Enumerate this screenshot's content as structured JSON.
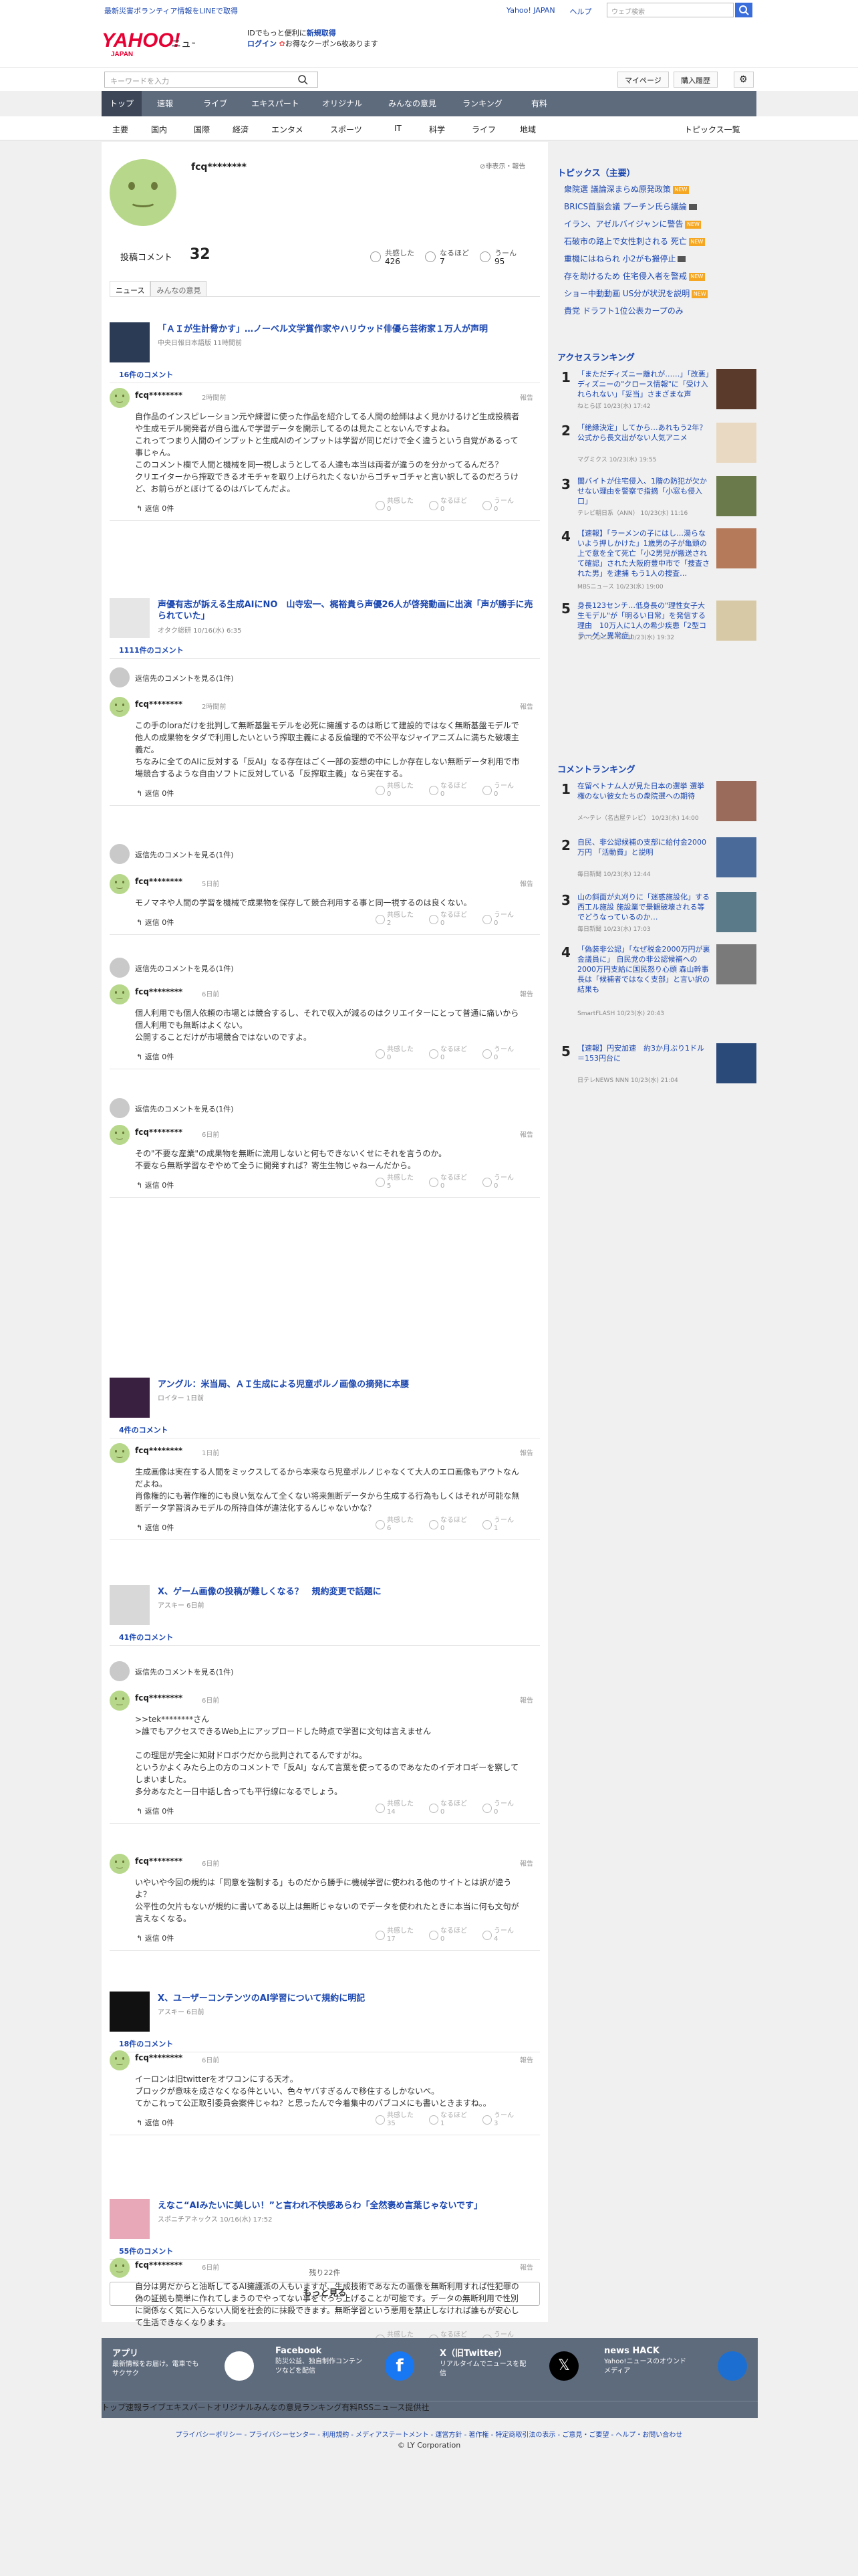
{
  "topbar": {
    "disaster_link": "最新災害ボランティア情報をLINEで取得",
    "yahoo_japan": "Yahoo! JAPAN",
    "help": "ヘルプ",
    "web_search_placeholder": "ウェブ検索"
  },
  "header": {
    "logo_text": "YAHOO! JAPAN",
    "service": "ニュース",
    "promo_line1": "IDでもっと便利に",
    "promo_line1_link": "新規取得",
    "promo_login": "ログイン",
    "promo_coupon": "お得なクーポン6枚あります"
  },
  "search": {
    "placeholder": "キーワードを入力",
    "mypage": "マイページ",
    "history": "購入履歴"
  },
  "gnav": [
    "トップ",
    "速報",
    "ライブ",
    "エキスパート",
    "オリジナル",
    "みんなの意見",
    "ランキング",
    "有料"
  ],
  "subnav": [
    "主要",
    "国内",
    "国際",
    "経済",
    "エンタメ",
    "スポーツ",
    "IT",
    "科学",
    "ライフ",
    "地域"
  ],
  "subnav_right": "トピックス一覧",
  "profile": {
    "name": "fcq********",
    "hide": "非表示・報告",
    "posts_label": "投稿コメント",
    "posts_count": "32",
    "empathy_label": "共感した",
    "empathy": "426",
    "naruhodo_label": "なるほど",
    "naruhodo": "7",
    "uun_label": "うーん",
    "uun": "95"
  },
  "tabs": [
    "ニュース",
    "みんなの意見"
  ],
  "labels": {
    "report": "報告",
    "reply": "返信",
    "reply_count": "0件",
    "empathy": "共感した",
    "naruhodo": "なるほど",
    "uun": "うーん",
    "more_replies": "返信先のコメントを見る(1件)",
    "remaining": "残り22件",
    "more": "もっと見る"
  },
  "articles": [
    {
      "title": "「ＡＩが生計脅かす」…ノーベル文学賞作家やハリウッド俳優ら芸術家１万人が声明",
      "src": "中央日報日本語版 11時間前",
      "count": "16件のコメント",
      "comments": [
        {
          "name": "fcq********",
          "time": "2時間前",
          "body": "自作品のインスピレーション元や練習に使った作品を紹介してる人間の絵師はよく見かけるけど生成投稿者や生成モデル開発者が自ら進んで学習データを開示してるのは見たことないんですよね。\nこれってつまり人間のインプットと生成AIのインプットは学習が同じだけで全く違うという自覚があるって事じゃん。\nこのコメント欄で人間と機械を同一視しようとしてる人達も本当は両者が違うのを分かってるんだろ？\nクリエイターから搾取できるオモチャを取り上げられたくないからゴチャゴチャと言い訳してるのだろうけど、お前らがとぼけてるのはバレてんだよ。",
          "e": "0",
          "n": "0",
          "u": "0"
        }
      ]
    },
    {
      "title": "声優有志が訴える生成AIにNO　山寺宏一、梶裕貴ら声優26人が啓発動画に出演「声が勝手に売られていた」",
      "src": "オタク総研 10/16(水) 6:35",
      "count": "1111件のコメント",
      "comments": [
        {
          "name": "fcq********",
          "time": "2時間前",
          "body": "この手のloraだけを批判して無断基盤モデルを必死に擁護するのは断じて建設的ではなく無断基盤モデルで他人の成果物をタダで利用したいという搾取主義による反倫理的で不公平なジャイアニズムに満ちた破壊主義だ。\nちなみに全てのAIに反対する「反AI」なる存在はごく一部の妄想の中にしか存在しない無断データ利用で市場競合するような自由ソフトに反対している「反搾取主義」なら実在する。",
          "e": "0",
          "n": "0",
          "u": "0"
        },
        {
          "name": "fcq********",
          "time": "5日前",
          "body": "モノマネや人間の学習を機械で成果物を保存して競合利用する事と同一視するのは良くない。",
          "e": "2",
          "n": "0",
          "u": "0"
        },
        {
          "name": "fcq********",
          "time": "6日前",
          "body": "個人利用でも個人依頼の市場とは競合するし、それで収入が減るのはクリエイターにとって普通に痛いから個人利用でも無断はよくない。\n公開することだけが市場競合ではないのですよ。",
          "e": "0",
          "n": "0",
          "u": "0"
        },
        {
          "name": "fcq********",
          "time": "6日前",
          "body": "その\"不要な産業\"の成果物を無断に流用しないと何もできないくせにそれを言うのか。\n不要なら無断学習なぞやめて全うに開発すれば？寄生生物じゃねーんだから。",
          "e": "5",
          "n": "0",
          "u": "0"
        }
      ]
    },
    {
      "title": "アングル：米当局、ＡＩ生成による児童ポルノ画像の摘発に本腰",
      "src": "ロイター 1日前",
      "count": "4件のコメント",
      "comments": [
        {
          "name": "fcq********",
          "time": "1日前",
          "body": "生成画像は実在する人間をミックスしてるから本来なら児童ポルノじゃなくて大人のエロ画像もアウトなんだよね。\n肖像権的にも著作権的にも良い気なんて全くない将来無断データから生成する行為もしくはそれが可能な無断データ学習済みモデルの所持自体が違法化するんじゃないかな？",
          "e": "6",
          "n": "0",
          "u": "1"
        }
      ]
    },
    {
      "title": "X、ゲーム画像の投稿が難しくなる？　規約変更で話題に",
      "src": "アスキー 6日前",
      "count": "41件のコメント",
      "comments": [
        {
          "name": "fcq********",
          "time": "6日前",
          "body": ">>tek********さん\n>誰でもアクセスできるWeb上にアップロードした時点で学習に文句は言えません\n\nこの理屈が完全に知財ドロボウだから批判されてるんですがね。\nというかよくみたら上の方のコメントで「反AI」なんて言葉を使ってるのであなたのイデオロギーを察してしまいました。\n多分あなたと一日中話し合っても平行線になるでしょう。",
          "e": "14",
          "n": "0",
          "u": "0"
        },
        {
          "name": "fcq********",
          "time": "6日前",
          "body": "いやいや今回の規約は「同意を強制する」ものだから勝手に機械学習に使われる他のサイトとは訳が違うよ？\n公平性の欠片もないが規約に書いてある以上は無断じゃないのでデータを使われたときに本当に何も文句が言えなくなる。",
          "e": "17",
          "n": "0",
          "u": "4"
        }
      ]
    },
    {
      "title": "X、ユーザーコンテンツのAI学習について規約に明記",
      "src": "アスキー 6日前",
      "count": "18件のコメント",
      "comments": [
        {
          "name": "fcq********",
          "time": "6日前",
          "body": "イーロンは旧twitterをオワコンにする天才。\nブロックが意味を成さなくなる件といい、色々ヤバすぎるんで移住するしかないべ。\nてかこれって公正取引委員会案件じゃね？と思ったんで今着集中のパブコメにも書いときますね。。",
          "e": "35",
          "n": "1",
          "u": "3"
        }
      ]
    },
    {
      "title": "えなこ“AIみたいに美しい！”と言われ不快感あらわ「全然褒め言葉じゃないです」",
      "src": "スポニチアネックス 10/16(水) 17:52",
      "count": "55件のコメント",
      "comments": [
        {
          "name": "fcq********",
          "time": "6日前",
          "body": "自分は男だからと油断してるAI擁護派の人もいますが、生成技術であなたの画像を無断利用すれば性犯罪の偽の証拠も簡単に作れてしまうのでやってない事をでっち上げることが可能です。データの無断利用で性別に関係なく気に入らない人間を社会的に抹殺できます。無断学習という悪用を禁止しなければ誰もが安心して生活できなくなります。",
          "e": "10",
          "n": "1",
          "u": "0"
        }
      ]
    }
  ],
  "sidebar": {
    "topics_title": "トピックス（主要）",
    "topics": [
      {
        "t": "衆院選 議論深まらぬ原発政策",
        "b": "NEW"
      },
      {
        "t": "BRICS首脳会議 プーチン氏ら議論",
        "b": "cam"
      },
      {
        "t": "イラン、アゼルバイジャンに警告",
        "b": "NEW"
      },
      {
        "t": "石破市の路上で女性刺される 死亡",
        "b": "NEW"
      },
      {
        "t": "重機にはねられ 小2がも搬停止",
        "b": "cam"
      },
      {
        "t": "存を助けるため 住宅侵入者を警戒",
        "b": "NEW"
      },
      {
        "t": "ショー中動動画 US分が状況を説明",
        "b": "NEW"
      },
      {
        "t": "貴党 ドラフト1位公表カープのみ",
        "b": ""
      }
    ],
    "access_title": "アクセスランキング",
    "access": [
      {
        "n": "1",
        "t": "「まただディズニー離れが……」「改悪」ディズニーの\"クロース情報\"に「受け入れられない」「妥当」さまざまな声",
        "s": "ねとらぼ 10/23(水) 17:42",
        "c": "#5a3a2a"
      },
      {
        "n": "2",
        "t": "「絶縁決定」してから…あれもう2年？　公式から長文出がない人気アニメ",
        "s": "マグミクス 10/23(水) 19:55",
        "c": "#e9d9c2"
      },
      {
        "n": "3",
        "t": "闇バイトが住宅侵入、1階の防犯が欠かせない理由を警察で指摘「小窓も侵入口」",
        "s": "テレビ朝日系（ANN） 10/23(水) 11:16",
        "c": "#6b7a4a"
      },
      {
        "n": "4",
        "t": "【速報】「ラーメンの子にはし…湯らないよう押しかけた」1歳男の子が亀頭の上で意を全て死亡「小2男児が搬送されて確認」された大阪府豊中市で「捜査された男」を逮捕 もう1人の捜査…",
        "s": "MBSニュース 10/23(水) 19:00",
        "c": "#b57a5a"
      },
      {
        "n": "5",
        "t": "身長123センチ…低身長の\"理性女子大生モデル\"が「明るい日常」を発信する理由　10万人に1人の希少疾患「2型コラーゲン異常症」",
        "s": "まいどなニュース 10/23(水) 19:32",
        "c": "#d7c9a5"
      }
    ],
    "comment_title": "コメントランキング",
    "comment": [
      {
        "n": "1",
        "t": "在留ベトナム人が見た日本の選挙 選挙権のない彼女たちの衆院選への期待",
        "s": "メ〜テレ（名古屋テレビ） 10/23(水) 14:00",
        "c": "#9a6a5a"
      },
      {
        "n": "2",
        "t": "自民、非公認候補の支部に給付金2000万円 「活動費」と説明",
        "s": "毎日新聞 10/23(水) 12:44",
        "c": "#4a6a9a"
      },
      {
        "n": "3",
        "t": "山の斜面が丸刈りに「迷惑施設化」する西工ル施設 施設業で景観破壊される等でどうなっているのか…",
        "s": "毎日新聞 10/23(水) 17:03",
        "c": "#5a7a8a"
      },
      {
        "n": "4",
        "t": "「偽装非公認」「なぜ税金2000万円が裏金議員に」 自民党の非公認候補への2000万円支給に国民怒り心頭 森山幹事長は「候補者ではなく支部」と言い訳の結果も",
        "s": "SmartFLASH 10/23(水) 20:43",
        "c": "#7a7a7a"
      },
      {
        "n": "5",
        "t": "【速報】円安加速　約3か月ぶり1ドル＝153円台に",
        "s": "日テレNEWS NNN 10/23(水) 21:04",
        "c": "#2a4a7a"
      }
    ]
  },
  "footer": {
    "app_t": "アプリ",
    "app_d": "最新情報をお届け。電車でもサクサク",
    "fb_t": "Facebook",
    "fb_d": "防災公益、独自制作コンテンツなどを配信",
    "x_t": "X（旧Twitter）",
    "x_d": "リアルタイムでニュースを配信",
    "hack_t": "news HACK",
    "hack_d": "Yahoo!ニュースのオウンドメディア",
    "nav": [
      "トップ",
      "速報",
      "ライブ",
      "エキスパート",
      "オリジナル",
      "みんなの意見",
      "ランキング",
      "有料",
      "RSS",
      "ニュース提供社"
    ],
    "legal": "プライバシーポリシー - プライバシーセンター - 利用規約 - メディアステートメント - 運営方針 - 著作権 - 特定商取引法の表示 - ご意見・ご要望 - ヘルプ・お問い合わせ",
    "copy": "© LY Corporation"
  }
}
